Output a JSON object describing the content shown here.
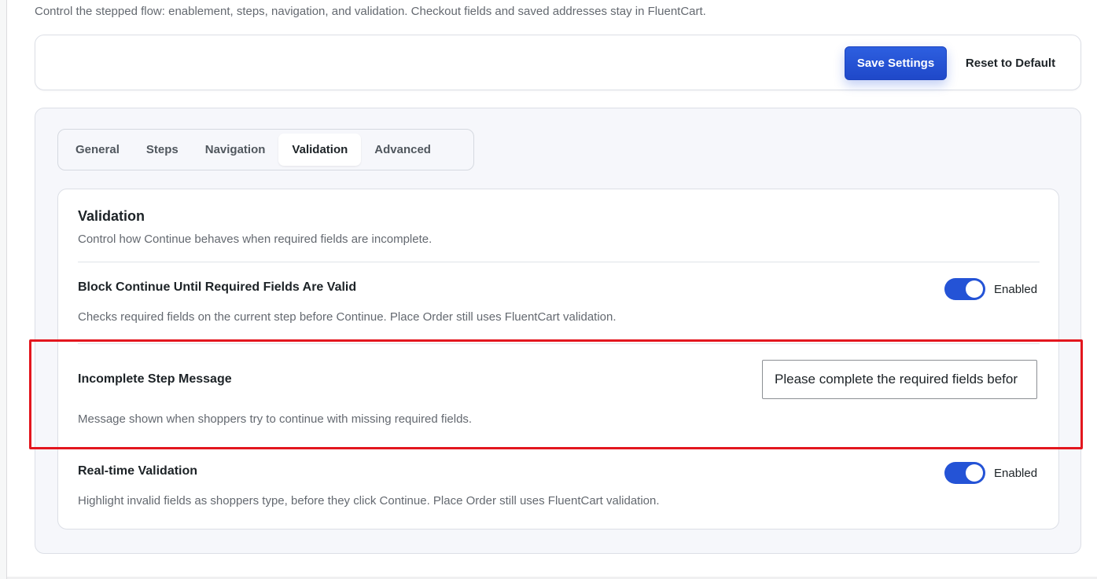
{
  "header": {
    "intro": "Control the stepped flow: enablement, steps, navigation, and validation. Checkout fields and saved addresses stay in FluentCart."
  },
  "actions": {
    "save_label": "Save Settings",
    "reset_label": "Reset to Default"
  },
  "tabs": [
    {
      "label": "General",
      "active": false
    },
    {
      "label": "Steps",
      "active": false
    },
    {
      "label": "Navigation",
      "active": false
    },
    {
      "label": "Validation",
      "active": true
    },
    {
      "label": "Advanced",
      "active": false
    }
  ],
  "panel": {
    "title": "Validation",
    "subtitle": "Control how Continue behaves when required fields are incomplete.",
    "block_continue": {
      "title": "Block Continue Until Required Fields Are Valid",
      "description": "Checks required fields on the current step before Continue. Place Order still uses FluentCart validation.",
      "toggle_on": true,
      "toggle_label": "Enabled"
    },
    "incomplete_message": {
      "title": "Incomplete Step Message",
      "description": "Message shown when shoppers try to continue with missing required fields.",
      "value": "Please complete the required fields befor"
    },
    "realtime": {
      "title": "Real-time Validation",
      "description": "Highlight invalid fields as shoppers type, before they click Continue. Place Order still uses FluentCart validation.",
      "toggle_on": true,
      "toggle_label": "Enabled"
    }
  },
  "colors": {
    "accent": "#2453d6",
    "highlight_border": "#e3161e"
  }
}
